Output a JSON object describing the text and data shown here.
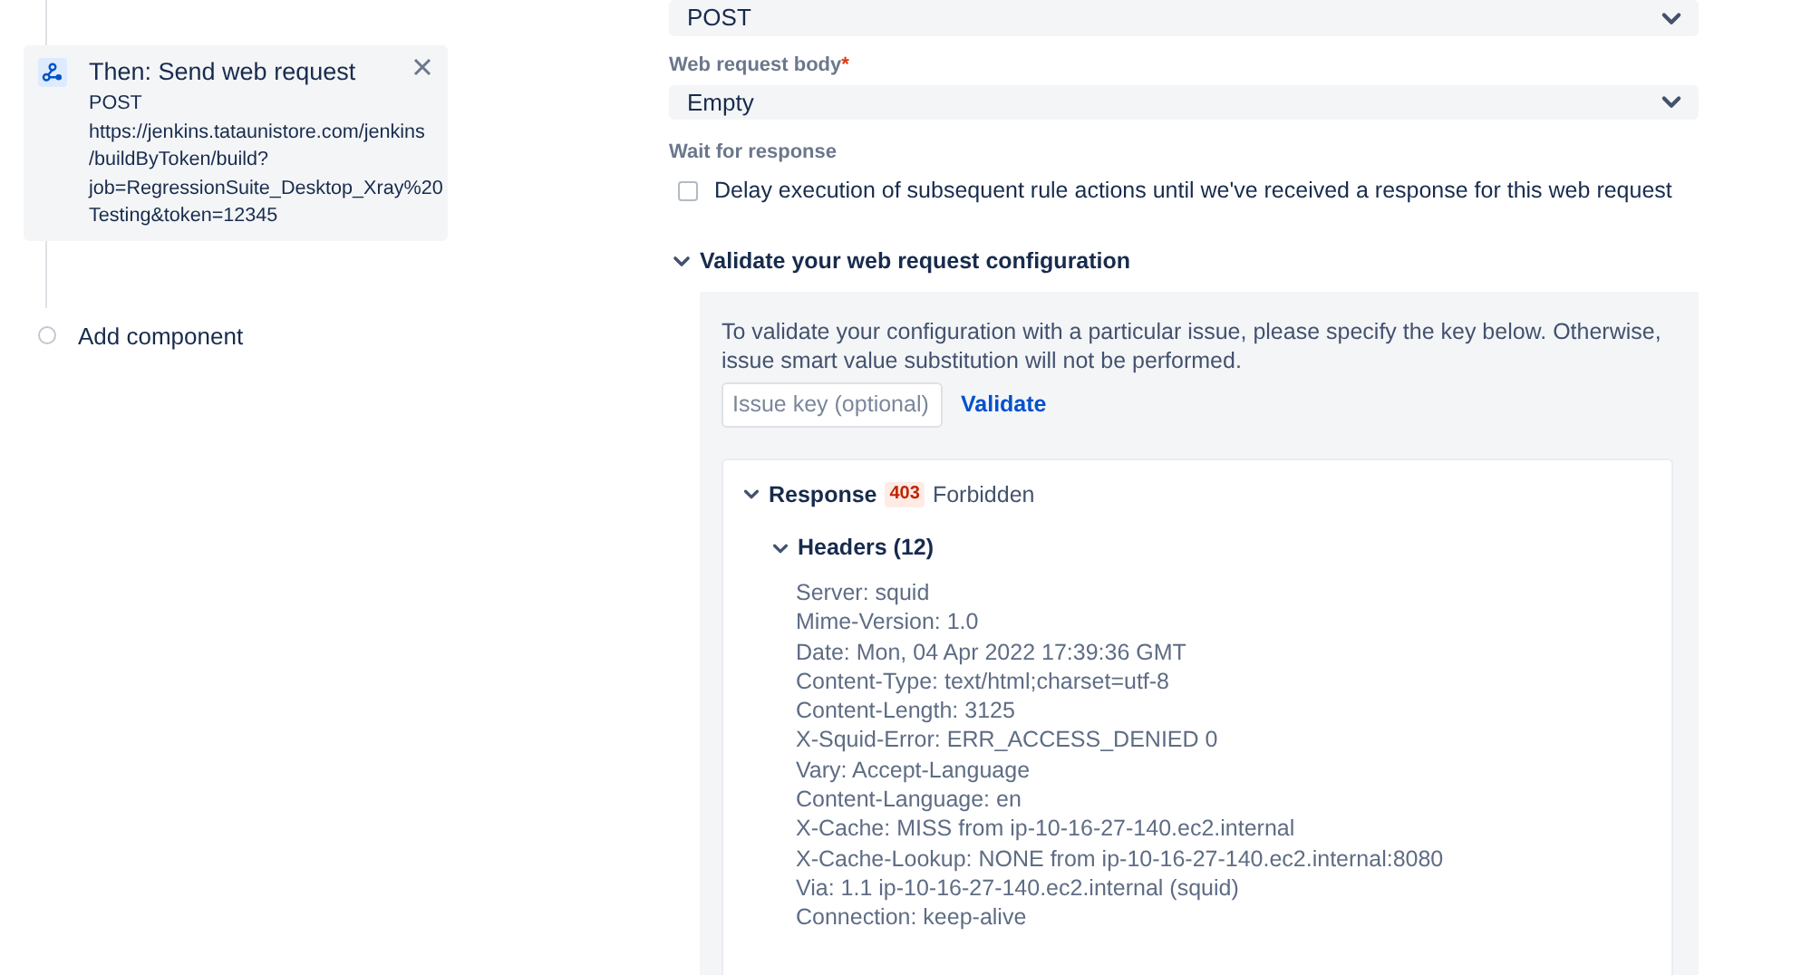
{
  "rule_steps": [
    {
      "kind": "action",
      "title": "Then: Send web request",
      "lines": [
        "POST",
        "https://jenkins.tataunistore.com/jenkins",
        "/buildByToken/build?",
        "job=RegressionSuite_Desktop_Xray%20",
        "Testing&token=12345"
      ]
    },
    {
      "kind": "add",
      "title": "Add component"
    }
  ],
  "method_select": {
    "value": "POST"
  },
  "body_field": {
    "label": "Web request body",
    "required_mark": "*",
    "value": "Empty"
  },
  "wait_for_response": {
    "label": "Wait for response",
    "checkbox_label": "Delay execution of subsequent rule actions until we've received a response for this web request",
    "checked": false
  },
  "validate_section": {
    "title": "Validate your web request configuration",
    "expanded": true,
    "description": "To validate your configuration with a particular issue, please specify the key below. Otherwise, issue smart value substitution will not be performed.",
    "issue_key": {
      "placeholder": "Issue key (optional)"
    },
    "validate_link": "Validate",
    "response": {
      "label": "Response",
      "status_code": "403",
      "status_text": "Forbidden",
      "expanded": true,
      "headers": {
        "title": "Headers (12)",
        "expanded": true,
        "lines": [
          "Server: squid",
          "Mime-Version: 1.0",
          "Date: Mon, 04 Apr 2022 17:39:36 GMT",
          "Content-Type: text/html;charset=utf-8",
          "Content-Length: 3125",
          "X-Squid-Error: ERR_ACCESS_DENIED 0",
          "Vary: Accept-Language",
          "Content-Language: en",
          "X-Cache: MISS from ip-10-16-27-140.ec2.internal",
          "X-Cache-Lookup: NONE from ip-10-16-27-140.ec2.internal:8080",
          "Via: 1.1 ip-10-16-27-140.ec2.internal (squid)",
          "Connection: keep-alive"
        ]
      }
    }
  }
}
